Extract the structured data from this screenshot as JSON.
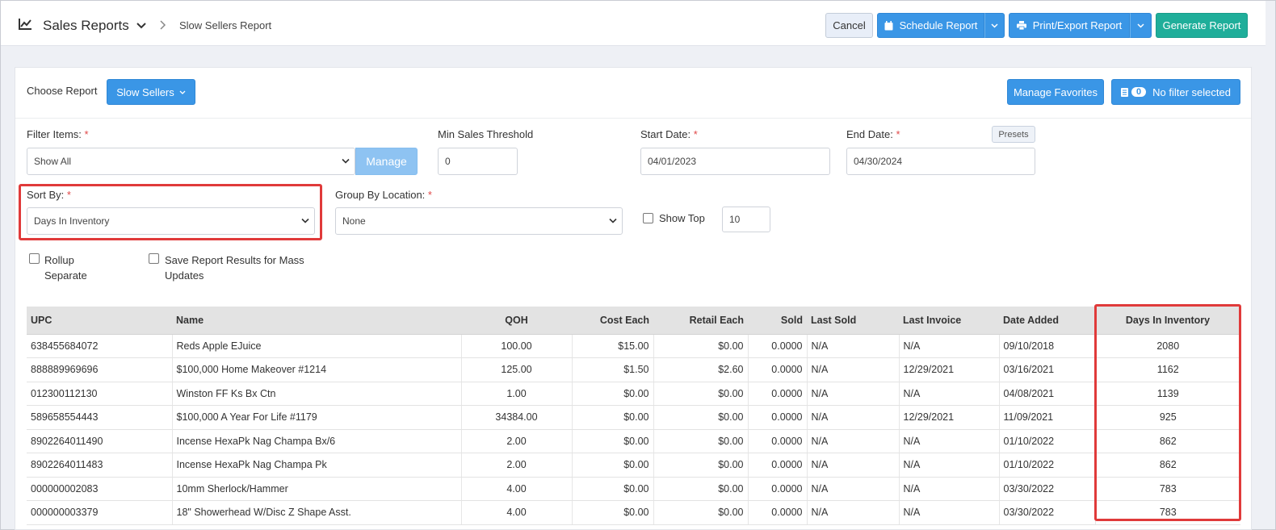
{
  "header": {
    "title": "Sales Reports",
    "breadcrumb": "Slow Sellers Report",
    "cancel_label": "Cancel",
    "schedule_label": "Schedule Report",
    "print_label": "Print/Export Report",
    "generate_label": "Generate Report"
  },
  "choose_report": {
    "label": "Choose Report",
    "value": "Slow Sellers",
    "manage_favorites_label": "Manage Favorites",
    "filter_count": "0",
    "filter_label": "No filter selected"
  },
  "filters": {
    "filter_items_label": "Filter Items:",
    "filter_items_value": "Show All",
    "manage_label": "Manage",
    "min_sales_label": "Min Sales Threshold",
    "min_sales_value": "0",
    "start_date_label": "Start Date:",
    "start_date_value": "04/01/2023",
    "end_date_label": "End Date:",
    "end_date_value": "04/30/2024",
    "presets_label": "Presets",
    "sort_by_label": "Sort By:",
    "sort_by_value": "Days In Inventory",
    "group_by_label": "Group By Location:",
    "group_by_value": "None",
    "show_top_label": "Show Top",
    "show_top_value": "10",
    "rollup_label_1": "Rollup",
    "rollup_label_2": "Separate",
    "save_results_label_1": "Save Report Results for Mass",
    "save_results_label_2": "Updates",
    "required_mark": "*"
  },
  "table": {
    "columns": [
      "UPC",
      "Name",
      "QOH",
      "Cost Each",
      "Retail Each",
      "Sold",
      "Last Sold",
      "Last Invoice",
      "Date Added",
      "Days In Inventory"
    ],
    "rows": [
      [
        "638455684072",
        "Reds Apple EJuice",
        "100.00",
        "$15.00",
        "$0.00",
        "0.0000",
        "N/A",
        "N/A",
        "09/10/2018",
        "2080"
      ],
      [
        "888889969696",
        "$100,000 Home Makeover #1214",
        "125.00",
        "$1.50",
        "$2.60",
        "0.0000",
        "N/A",
        "12/29/2021",
        "03/16/2021",
        "1162"
      ],
      [
        "012300112130",
        "Winston FF Ks Bx Ctn",
        "1.00",
        "$0.00",
        "$0.00",
        "0.0000",
        "N/A",
        "N/A",
        "04/08/2021",
        "1139"
      ],
      [
        "589658554443",
        "$100,000 A Year For Life #1179",
        "34384.00",
        "$0.00",
        "$0.00",
        "0.0000",
        "N/A",
        "12/29/2021",
        "11/09/2021",
        "925"
      ],
      [
        "8902264011490",
        "Incense HexaPk Nag Champa Bx/6",
        "2.00",
        "$0.00",
        "$0.00",
        "0.0000",
        "N/A",
        "N/A",
        "01/10/2022",
        "862"
      ],
      [
        "8902264011483",
        "Incense HexaPk Nag Champa Pk",
        "2.00",
        "$0.00",
        "$0.00",
        "0.0000",
        "N/A",
        "N/A",
        "01/10/2022",
        "862"
      ],
      [
        "000000002083",
        "10mm Sherlock/Hammer",
        "4.00",
        "$0.00",
        "$0.00",
        "0.0000",
        "N/A",
        "N/A",
        "03/30/2022",
        "783"
      ],
      [
        "000000003379",
        "18\" Showerhead W/Disc Z Shape Asst.",
        "4.00",
        "$0.00",
        "$0.00",
        "0.0000",
        "N/A",
        "N/A",
        "03/30/2022",
        "783"
      ]
    ]
  },
  "colors": {
    "primary_blue": "#3a96e6",
    "teal": "#1fae9a",
    "highlight_red": "#e03a3a"
  }
}
